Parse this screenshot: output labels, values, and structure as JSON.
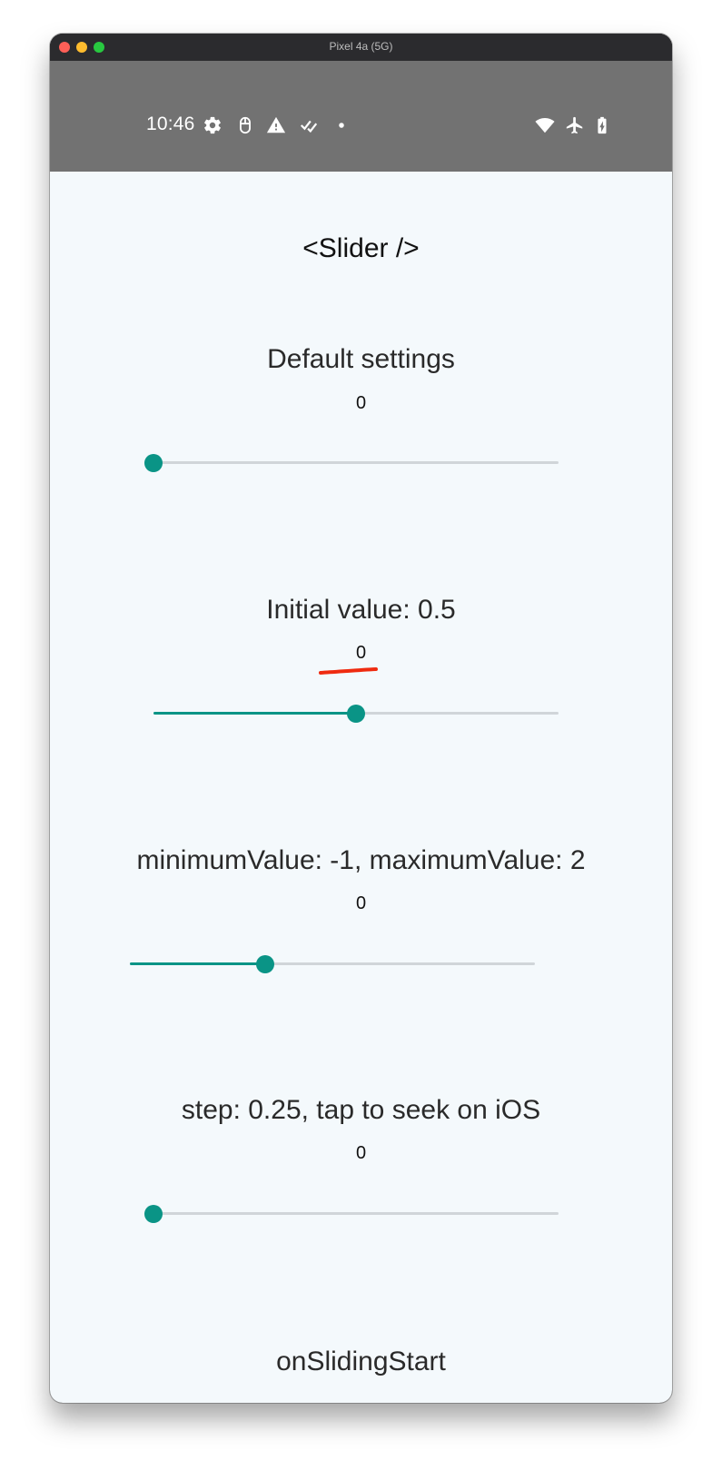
{
  "window": {
    "title": "Pixel 4a (5G)"
  },
  "status_bar": {
    "time": "10:46",
    "left_icons": [
      "gear-icon",
      "mouse-icon",
      "warning-icon",
      "checklist-icon",
      "notification-dot-icon"
    ],
    "right_icons": [
      "wifi-icon",
      "airplane-mode-icon",
      "battery-charging-icon"
    ]
  },
  "screen": {
    "title": "<Slider />",
    "accent_color": "#0a9486",
    "sections": [
      {
        "title": "Default settings",
        "value": "0",
        "slider": {
          "min": 0,
          "max": 1,
          "value": 0
        }
      },
      {
        "title": "Initial value: 0.5",
        "value": "0",
        "slider": {
          "min": 0,
          "max": 1,
          "value": 0.5
        }
      },
      {
        "title": "minimumValue: -1, maximumValue: 2",
        "value": "0",
        "slider": {
          "min": -1,
          "max": 2,
          "value": 0
        }
      },
      {
        "title": "step: 0.25, tap to seek on iOS",
        "value": "0",
        "slider": {
          "min": 0,
          "max": 1,
          "value": 0
        }
      },
      {
        "title": "onSlidingStart"
      }
    ]
  }
}
